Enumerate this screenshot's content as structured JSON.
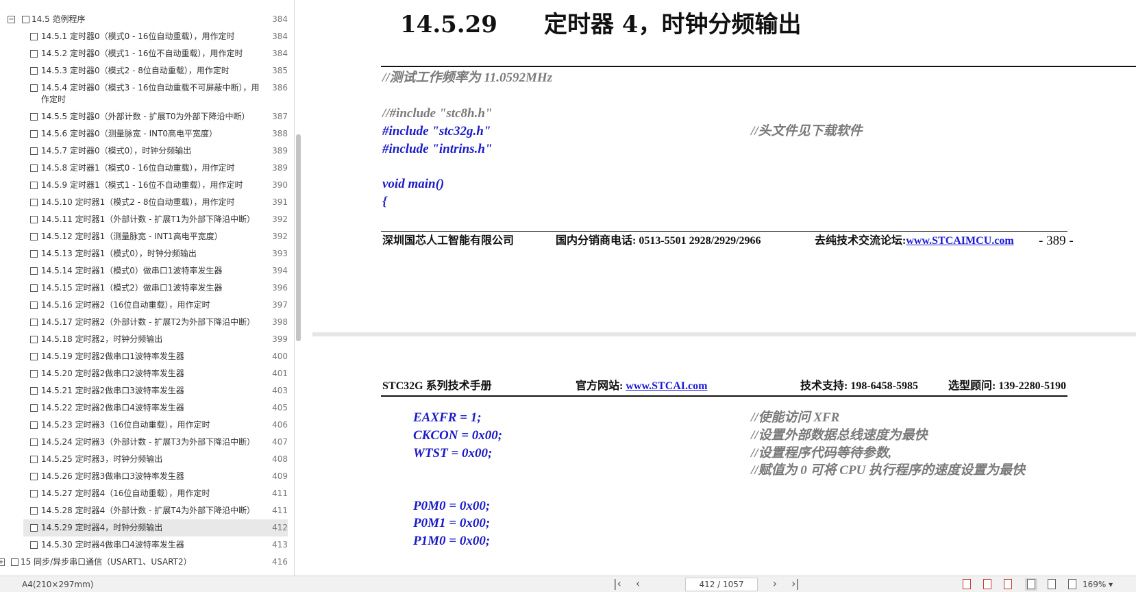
{
  "sidebar": {
    "items": [
      {
        "label": "14.5 范例程序",
        "page": "384",
        "level": 0,
        "expander": "⊟"
      },
      {
        "label": "14.5.1 定时器0（模式0 - 16位自动重载），用作定时",
        "page": "384",
        "level": 1
      },
      {
        "label": "14.5.2 定时器0（模式1 - 16位不自动重载），用作定时",
        "page": "384",
        "level": 1
      },
      {
        "label": "14.5.3 定时器0（模式2 - 8位自动重载），用作定时",
        "page": "385",
        "level": 1
      },
      {
        "label": "14.5.4 定时器0（模式3 - 16位自动重载不可屏蔽中断），用作定时",
        "page": "386",
        "level": 1,
        "tall": true
      },
      {
        "label": "14.5.5 定时器0（外部计数 - 扩展T0为外部下降沿中断）",
        "page": "387",
        "level": 1
      },
      {
        "label": "14.5.6 定时器0（测量脉宽 - INT0高电平宽度）",
        "page": "388",
        "level": 1
      },
      {
        "label": "14.5.7 定时器0（模式0），时钟分频输出",
        "page": "389",
        "level": 1
      },
      {
        "label": "14.5.8 定时器1（模式0 - 16位自动重载），用作定时",
        "page": "389",
        "level": 1
      },
      {
        "label": "14.5.9 定时器1（模式1 - 16位不自动重载），用作定时",
        "page": "390",
        "level": 1
      },
      {
        "label": "14.5.10 定时器1（模式2 - 8位自动重载），用作定时",
        "page": "391",
        "level": 1
      },
      {
        "label": "14.5.11 定时器1（外部计数 - 扩展T1为外部下降沿中断）",
        "page": "392",
        "level": 1
      },
      {
        "label": "14.5.12 定时器1（测量脉宽 - INT1高电平宽度）",
        "page": "392",
        "level": 1
      },
      {
        "label": "14.5.13 定时器1（模式0），时钟分频输出",
        "page": "393",
        "level": 1
      },
      {
        "label": "14.5.14 定时器1（模式0）做串口1波特率发生器",
        "page": "394",
        "level": 1
      },
      {
        "label": "14.5.15 定时器1（模式2）做串口1波特率发生器",
        "page": "396",
        "level": 1
      },
      {
        "label": "14.5.16 定时器2（16位自动重载），用作定时",
        "page": "397",
        "level": 1
      },
      {
        "label": "14.5.17 定时器2（外部计数 - 扩展T2为外部下降沿中断）",
        "page": "398",
        "level": 1
      },
      {
        "label": "14.5.18 定时器2，时钟分频输出",
        "page": "399",
        "level": 1
      },
      {
        "label": "14.5.19 定时器2做串口1波特率发生器",
        "page": "400",
        "level": 1
      },
      {
        "label": "14.5.20 定时器2做串口2波特率发生器",
        "page": "401",
        "level": 1
      },
      {
        "label": "14.5.21 定时器2做串口3波特率发生器",
        "page": "403",
        "level": 1
      },
      {
        "label": "14.5.22 定时器2做串口4波特率发生器",
        "page": "405",
        "level": 1
      },
      {
        "label": "14.5.23 定时器3（16位自动重载），用作定时",
        "page": "406",
        "level": 1
      },
      {
        "label": "14.5.24 定时器3（外部计数 - 扩展T3为外部下降沿中断）",
        "page": "407",
        "level": 1
      },
      {
        "label": "14.5.25 定时器3，时钟分频输出",
        "page": "408",
        "level": 1
      },
      {
        "label": "14.5.26 定时器3做串口3波特率发生器",
        "page": "409",
        "level": 1
      },
      {
        "label": "14.5.27 定时器4（16位自动重载），用作定时",
        "page": "411",
        "level": 1
      },
      {
        "label": "14.5.28 定时器4（外部计数 - 扩展T4为外部下降沿中断）",
        "page": "411",
        "level": 1
      },
      {
        "label": "14.5.29 定时器4，时钟分频输出",
        "page": "412",
        "level": 1,
        "active": true
      },
      {
        "label": "14.5.30 定时器4做串口4波特率发生器",
        "page": "413",
        "level": 1
      },
      {
        "label": "15 同步/异步串口通信（USART1、USART2）",
        "page": "416",
        "level": -1,
        "expander": "⊞"
      }
    ]
  },
  "document": {
    "title": "14.5.29　　定时器 4，时钟分频输出",
    "page_top": {
      "code": [
        {
          "text": "//测试工作频率为 11.0592MHz",
          "color": "gray"
        },
        {
          "text": "//#include \"stc8h.h\"",
          "color": "gray"
        },
        {
          "text": "#include \"stc32g.h\"",
          "color": "blue"
        },
        {
          "text": "//头文件见下载软件",
          "color": "gray"
        },
        {
          "text": "#include \"intrins.h\"",
          "color": "blue"
        },
        {
          "text": "void main()",
          "color": "blue"
        },
        {
          "text": "{",
          "color": "blue"
        }
      ],
      "footer": {
        "company": "深圳国芯人工智能有限公司",
        "phone": "国内分销商电话: 0513-5501 2928/2929/2966",
        "forum_label": "去纯技术交流论坛:",
        "forum_link": "www.STCAIMCU.com",
        "page_number": "- 389 -"
      }
    },
    "page_bottom": {
      "header": {
        "manual": "STC32G 系列技术手册",
        "site_label": "官方网站: ",
        "site_link": "www.STCAI.com",
        "support": "技术支持: 198-6458-5985",
        "advisor": "选型顾问: 139-2280-5190"
      },
      "code": [
        {
          "text": "EAXFR = 1;",
          "color": "blue"
        },
        {
          "text": "//使能访问 XFR",
          "color": "gray"
        },
        {
          "text": "CKCON = 0x00;",
          "color": "blue"
        },
        {
          "text": "//设置外部数据总线速度为最快",
          "color": "gray"
        },
        {
          "text": "WTST = 0x00;",
          "color": "blue"
        },
        {
          "text": "//设置程序代码等待参数,",
          "color": "gray"
        },
        {
          "text": "//赋值为 0 可将 CPU 执行程序的速度设置为最快",
          "color": "gray"
        },
        {
          "text": "P0M0 = 0x00;",
          "color": "blue"
        },
        {
          "text": "P0M1 = 0x00;",
          "color": "blue"
        },
        {
          "text": "P1M0 = 0x00;",
          "color": "blue"
        }
      ]
    }
  },
  "statusbar": {
    "page_size": "A4(210×297mm)",
    "first_page_icon": "first-page-icon",
    "prev_page_icon": "prev-page-icon",
    "page_indicator": "412 / 1057",
    "next_page_icon": "next-page-icon",
    "last_page_icon": "last-page-icon",
    "zoom": "169% ▾"
  },
  "colors": {
    "code_blue": "#1a1ac8",
    "comment_gray": "#7a7a7a",
    "link_blue": "#1a1ad8",
    "active_row": "#e8e8e8"
  }
}
